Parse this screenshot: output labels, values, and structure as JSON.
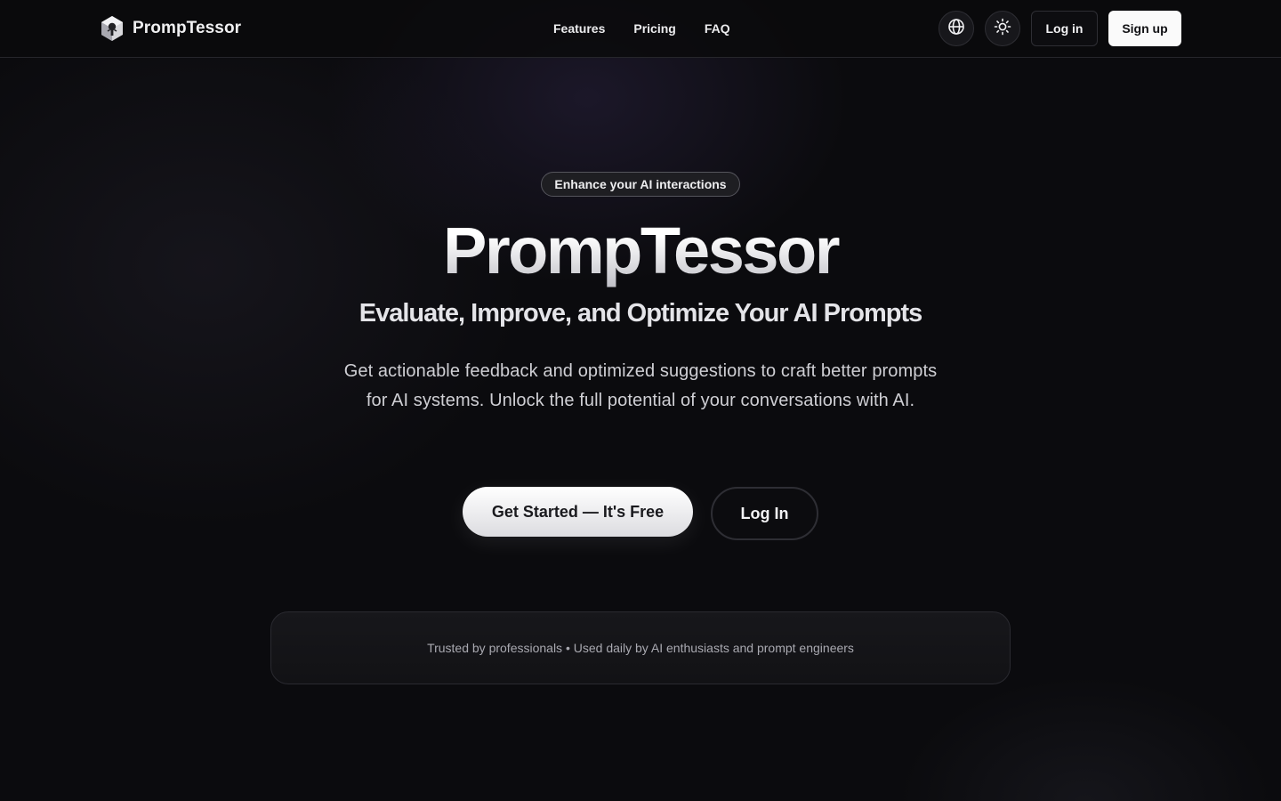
{
  "header": {
    "brand_name": "PrompTessor",
    "nav": [
      {
        "label": "Features"
      },
      {
        "label": "Pricing"
      },
      {
        "label": "FAQ"
      }
    ],
    "language_icon": "globe-icon",
    "theme_icon": "sun-icon",
    "login_label": "Log in",
    "signup_label": "Sign up"
  },
  "hero": {
    "badge": "Enhance your AI interactions",
    "title": "PrompTessor",
    "subtitle": "Evaluate, Improve, and Optimize Your AI Prompts",
    "description": "Get actionable feedback and optimized suggestions to craft better prompts for AI systems. Unlock the full potential of your conversations with AI.",
    "cta_primary": "Get Started — It's Free",
    "cta_secondary": "Log In"
  },
  "trust": {
    "text": "Trusted by professionals • Used daily by AI enthusiasts and prompt engineers"
  },
  "colors": {
    "background": "#0b0b0e",
    "primary_button": "#fafafa",
    "text": "#f4f4f5"
  }
}
